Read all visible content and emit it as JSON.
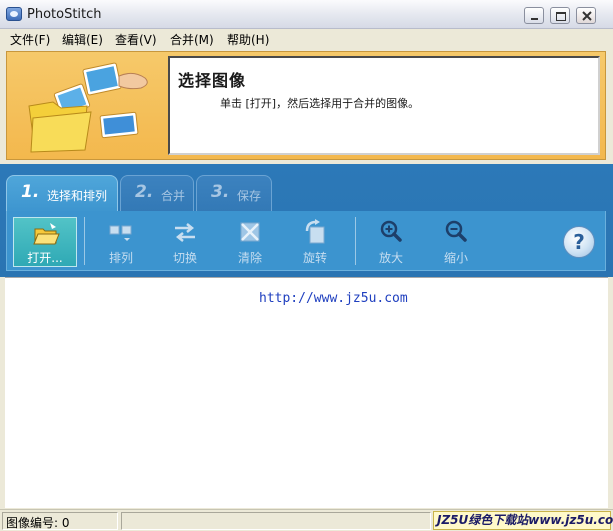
{
  "window": {
    "title": "PhotoStitch"
  },
  "menu": [
    {
      "label": "文件(F)"
    },
    {
      "label": "编辑(E)"
    },
    {
      "label": "查看(V)"
    },
    {
      "label": "合并(M)"
    },
    {
      "label": "帮助(H)"
    }
  ],
  "header": {
    "title": "选择图像",
    "description": "单击 [打开]，然后选择用于合并的图像。"
  },
  "tabs": [
    {
      "number": "1.",
      "label": "选择和排列",
      "active": true
    },
    {
      "number": "2.",
      "label": "合并",
      "active": false
    },
    {
      "number": "3.",
      "label": "保存",
      "active": false
    }
  ],
  "toolbar": {
    "open": "打开...",
    "arrange": "排列",
    "switch": "切换",
    "clear": "清除",
    "rotate": "旋转",
    "zoom_in": "放大",
    "zoom_out": "缩小",
    "help": "?"
  },
  "content": {
    "url_text": "http://www.jz5u.com"
  },
  "status": {
    "image_number": "图像编号: 0",
    "brand": "JZ5U绿色下载站www.jz5u.com"
  },
  "icons": {
    "app": "photostitch-icon",
    "open": "folder-open-icon",
    "arrange": "arrange-icon",
    "switch": "swap-arrows-icon",
    "clear": "clear-x-icon",
    "rotate": "rotate-icon",
    "zoom_in": "zoom-in-icon",
    "zoom_out": "zoom-out-icon",
    "help": "help-icon"
  },
  "colors": {
    "header_bg": "#f3b84d",
    "toolbar_bg": "#3c94cf",
    "active_tab": "#4fa6da",
    "open_button": "#2fa9b5"
  }
}
